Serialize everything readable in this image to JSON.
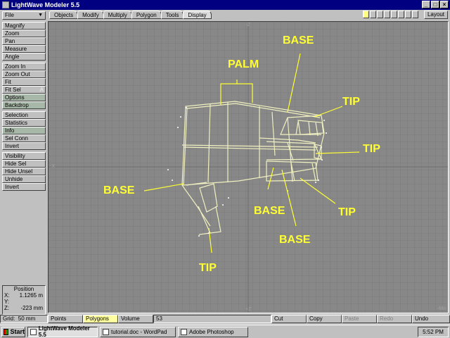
{
  "window": {
    "title": "LightWave Modeler 5.5"
  },
  "file_menu": {
    "label": "File"
  },
  "tabs": [
    {
      "label": "Objects"
    },
    {
      "label": "Modify"
    },
    {
      "label": "Multiply"
    },
    {
      "label": "Polygon"
    },
    {
      "label": "Tools"
    },
    {
      "label": "Display",
      "active": true
    }
  ],
  "layout_button": "Layout",
  "sidebar": {
    "view_group": [
      {
        "label": "Magnify",
        "key": ""
      },
      {
        "label": "Zoom",
        "key": ""
      },
      {
        "label": "Pan",
        "key": ""
      },
      {
        "label": "Measure",
        "key": ""
      },
      {
        "label": "Angle",
        "key": ""
      }
    ],
    "zoom_group": [
      {
        "label": "Zoom In",
        "key": ""
      },
      {
        "label": "Zoom Out",
        "key": ""
      },
      {
        "label": "Fit",
        "key": ""
      },
      {
        "label": "Fit Sel",
        "key": "A"
      },
      {
        "label": "Options",
        "key": "",
        "on": true
      },
      {
        "label": "Backdrop",
        "key": "",
        "on": true
      }
    ],
    "selection_group": [
      {
        "label": "Selection",
        "key": ""
      },
      {
        "label": "Statistics",
        "key": ""
      },
      {
        "label": "Info",
        "key": "",
        "on": true
      },
      {
        "label": "Sel Conn",
        "key": ""
      },
      {
        "label": "Invert",
        "key": ""
      }
    ],
    "visibility_group": [
      {
        "label": "Visibility",
        "key": ""
      },
      {
        "label": "Hide Sel",
        "key": ""
      },
      {
        "label": "Hide Unsel",
        "key": ""
      },
      {
        "label": "Unhide",
        "key": ""
      },
      {
        "label": "Invert",
        "key": ""
      }
    ]
  },
  "position": {
    "title": "Position",
    "x_label": "X:",
    "x_value": "1.1265 m",
    "y_label": "Y:",
    "y_value": "",
    "z_label": "Z:",
    "z_value": "-223 mm"
  },
  "viewport": {
    "axis_top": "-Z",
    "axis_left": "-X",
    "axis_bottom": "+Z",
    "corner": "-Mo",
    "annotations": {
      "palm": "PALM",
      "base_top": "BASE",
      "tip_1": "TIP",
      "tip_2": "TIP",
      "base_left": "BASE",
      "base_mid": "BASE",
      "tip_3": "TIP",
      "base_low": "BASE",
      "tip_bottom": "TIP"
    }
  },
  "bottombar": {
    "grid_label": "Grid:",
    "grid_value": "50 mm",
    "points": "Points",
    "polygons": "Polygons",
    "volume": "Volume",
    "count": "53",
    "cut": "Cut",
    "copy": "Copy",
    "paste": "Paste",
    "redo": "Redo",
    "undo": "Undo"
  },
  "taskbar": {
    "start": "Start",
    "tasks": [
      {
        "label": "LightWave Modeler 5.5",
        "active": true
      },
      {
        "label": "tutorial.doc - WordPad",
        "active": false
      },
      {
        "label": "Adobe Photoshop",
        "active": false
      }
    ],
    "clock": "5:52 PM"
  },
  "colors": {
    "viewport_bg": "#888888",
    "grid_line": "#7c7c7c",
    "annotation": "#ffff33",
    "titlebar": "#000080"
  }
}
